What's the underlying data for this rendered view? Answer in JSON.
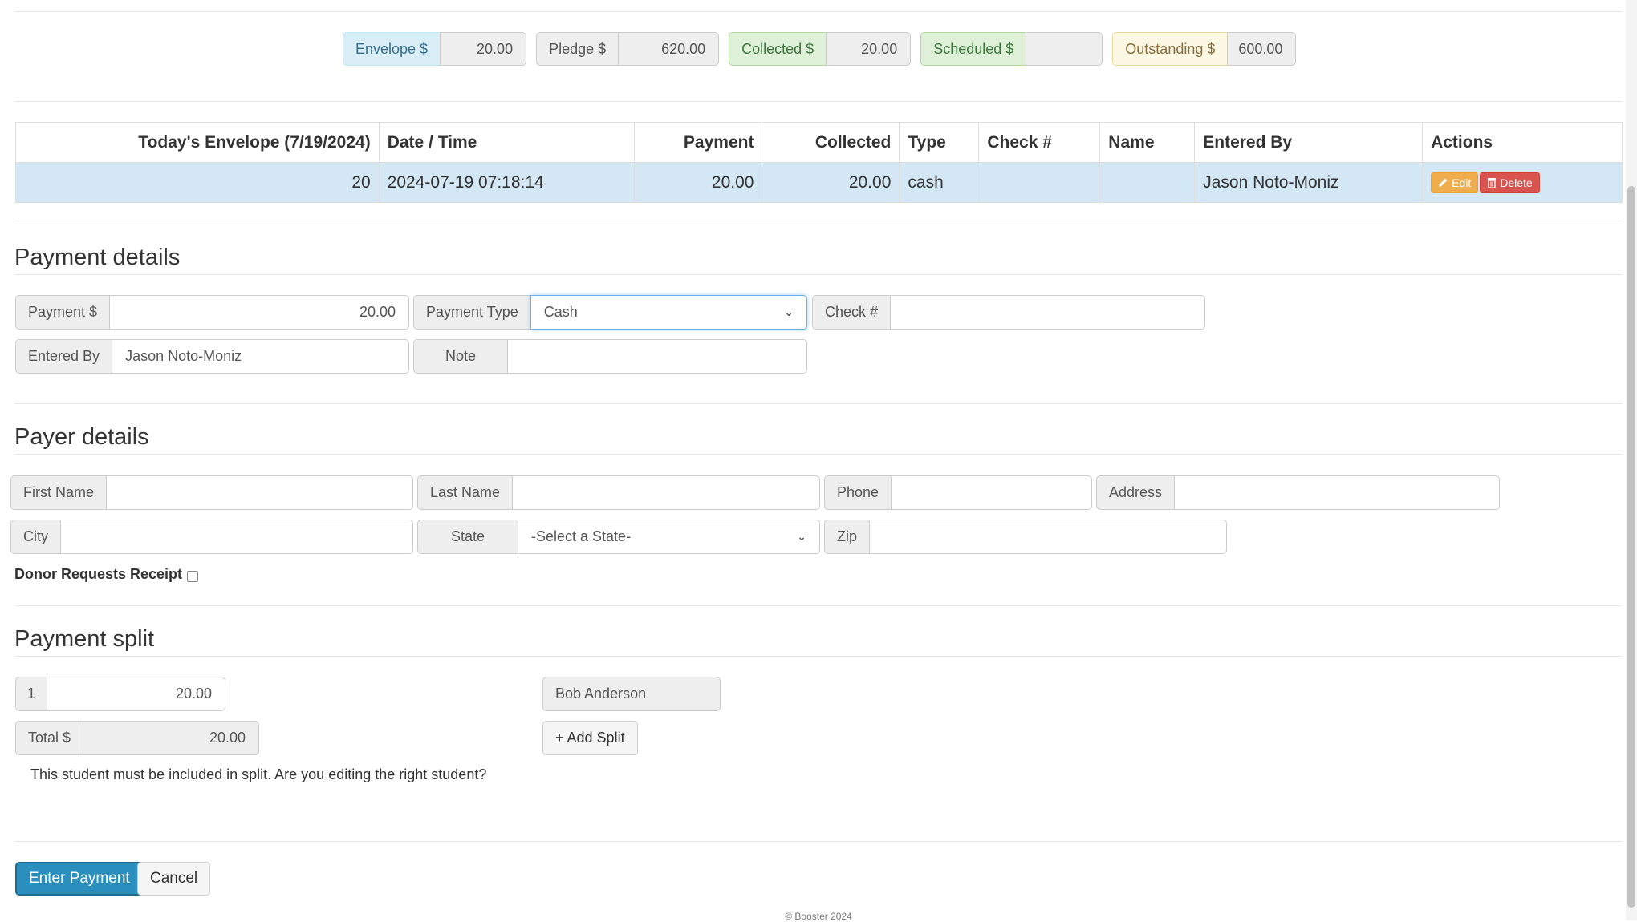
{
  "summary": {
    "envelope": {
      "label": "Envelope $",
      "value": "20.00"
    },
    "pledge": {
      "label": "Pledge $",
      "value": "620.00"
    },
    "collected": {
      "label": "Collected $",
      "value": "20.00"
    },
    "scheduled": {
      "label": "Scheduled $",
      "value": ""
    },
    "outstanding": {
      "label": "Outstanding $",
      "value": "600.00"
    }
  },
  "table": {
    "headers": [
      "Today's Envelope (7/19/2024)",
      "Date / Time",
      "Payment",
      "Collected",
      "Type",
      "Check #",
      "Name",
      "Entered By",
      "Actions"
    ],
    "rows": [
      {
        "envelope": "20",
        "datetime": "2024-07-19 07:18:14",
        "payment": "20.00",
        "collected": "20.00",
        "type": "cash",
        "check": "",
        "name": "",
        "entered_by": "Jason Noto-Moniz"
      }
    ],
    "edit_label": "Edit",
    "delete_label": "Delete"
  },
  "payment_details": {
    "heading": "Payment details",
    "payment_label": "Payment $",
    "payment_value": "20.00",
    "type_label": "Payment Type",
    "type_value": "Cash",
    "check_label": "Check #",
    "check_value": "",
    "entered_by_label": "Entered By",
    "entered_by_value": "Jason Noto-Moniz",
    "note_label": "Note",
    "note_value": ""
  },
  "payer_details": {
    "heading": "Payer details",
    "first_name_label": "First Name",
    "last_name_label": "Last Name",
    "phone_label": "Phone",
    "address_label": "Address",
    "city_label": "City",
    "state_label": "State",
    "state_value": "-Select a State-",
    "zip_label": "Zip",
    "receipt_label": "Donor Requests Receipt"
  },
  "payment_split": {
    "heading": "Payment split",
    "index": "1",
    "split_value": "20.00",
    "student": "Bob Anderson",
    "total_label": "Total $",
    "total_value": "20.00",
    "add_split": "+ Add Split",
    "notice": "This student must be included in split. Are you editing the right student?"
  },
  "buttons": {
    "enter": "Enter Payment",
    "cancel": "Cancel"
  },
  "footer": "© Booster 2024"
}
